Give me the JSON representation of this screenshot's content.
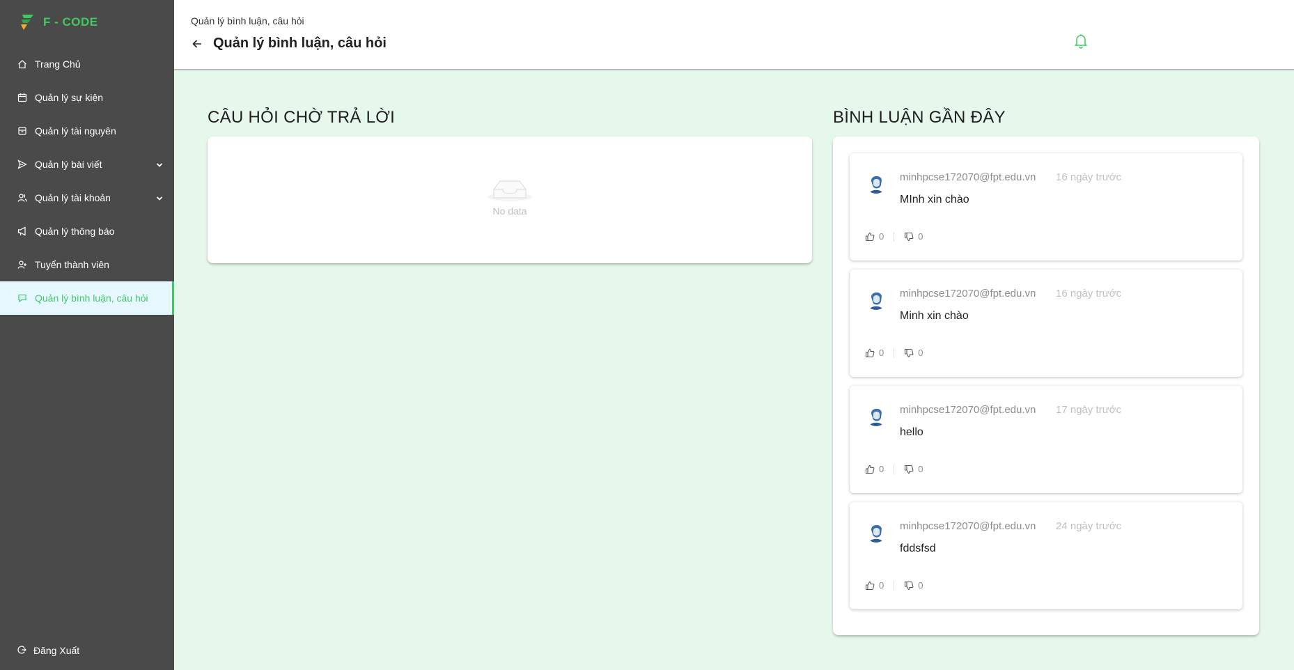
{
  "brand": {
    "name": "F - CODE"
  },
  "sidebar": {
    "items": [
      {
        "label": "Trang Chủ",
        "icon": "home-icon"
      },
      {
        "label": "Quản lý sự kiện",
        "icon": "calendar-icon"
      },
      {
        "label": "Quản lý tài nguyên",
        "icon": "inbox-icon"
      },
      {
        "label": "Quản lý bài viết",
        "icon": "send-icon"
      },
      {
        "label": "Quản lý tài khoản",
        "icon": "users-icon"
      },
      {
        "label": "Quản lý thông báo",
        "icon": "megaphone-icon"
      },
      {
        "label": "Tuyển thành viên",
        "icon": "user-add-icon"
      },
      {
        "label": "Quản lý bình luận, câu hỏi",
        "icon": "comment-icon"
      }
    ],
    "logout_label": "Đăng Xuất"
  },
  "header": {
    "breadcrumb": "Quản lý bình luận, câu hỏi",
    "title": "Quản lý bình luận, câu hỏi"
  },
  "questions": {
    "title": "CÂU HỎI CHỜ TRẢ LỜI",
    "empty_text": "No data"
  },
  "comments": {
    "title": "BÌNH LUẬN GẦN ĐÂY",
    "items": [
      {
        "author": "minhpcse172070@fpt.edu.vn",
        "time": "16 ngày trước",
        "text": "MInh xin chào",
        "likes": "0",
        "dislikes": "0"
      },
      {
        "author": "minhpcse172070@fpt.edu.vn",
        "time": "16 ngày trước",
        "text": "Minh xin chào",
        "likes": "0",
        "dislikes": "0"
      },
      {
        "author": "minhpcse172070@fpt.edu.vn",
        "time": "17 ngày trước",
        "text": "hello",
        "likes": "0",
        "dislikes": "0"
      },
      {
        "author": "minhpcse172070@fpt.edu.vn",
        "time": "24 ngày trước",
        "text": "fddsfsd",
        "likes": "0",
        "dislikes": "0"
      }
    ]
  },
  "colors": {
    "accent": "#3fcb5f",
    "sidebar_bg": "#4a4a4a",
    "page_bg": "#e6f7ec"
  }
}
